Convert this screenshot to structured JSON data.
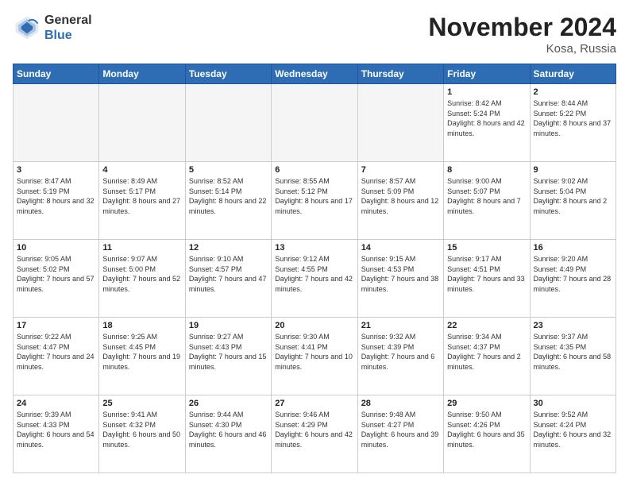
{
  "logo": {
    "general": "General",
    "blue": "Blue"
  },
  "header": {
    "month": "November 2024",
    "location": "Kosa, Russia"
  },
  "weekdays": [
    "Sunday",
    "Monday",
    "Tuesday",
    "Wednesday",
    "Thursday",
    "Friday",
    "Saturday"
  ],
  "weeks": [
    [
      {
        "day": "",
        "info": ""
      },
      {
        "day": "",
        "info": ""
      },
      {
        "day": "",
        "info": ""
      },
      {
        "day": "",
        "info": ""
      },
      {
        "day": "",
        "info": ""
      },
      {
        "day": "1",
        "info": "Sunrise: 8:42 AM\nSunset: 5:24 PM\nDaylight: 8 hours and 42 minutes."
      },
      {
        "day": "2",
        "info": "Sunrise: 8:44 AM\nSunset: 5:22 PM\nDaylight: 8 hours and 37 minutes."
      }
    ],
    [
      {
        "day": "3",
        "info": "Sunrise: 8:47 AM\nSunset: 5:19 PM\nDaylight: 8 hours and 32 minutes."
      },
      {
        "day": "4",
        "info": "Sunrise: 8:49 AM\nSunset: 5:17 PM\nDaylight: 8 hours and 27 minutes."
      },
      {
        "day": "5",
        "info": "Sunrise: 8:52 AM\nSunset: 5:14 PM\nDaylight: 8 hours and 22 minutes."
      },
      {
        "day": "6",
        "info": "Sunrise: 8:55 AM\nSunset: 5:12 PM\nDaylight: 8 hours and 17 minutes."
      },
      {
        "day": "7",
        "info": "Sunrise: 8:57 AM\nSunset: 5:09 PM\nDaylight: 8 hours and 12 minutes."
      },
      {
        "day": "8",
        "info": "Sunrise: 9:00 AM\nSunset: 5:07 PM\nDaylight: 8 hours and 7 minutes."
      },
      {
        "day": "9",
        "info": "Sunrise: 9:02 AM\nSunset: 5:04 PM\nDaylight: 8 hours and 2 minutes."
      }
    ],
    [
      {
        "day": "10",
        "info": "Sunrise: 9:05 AM\nSunset: 5:02 PM\nDaylight: 7 hours and 57 minutes."
      },
      {
        "day": "11",
        "info": "Sunrise: 9:07 AM\nSunset: 5:00 PM\nDaylight: 7 hours and 52 minutes."
      },
      {
        "day": "12",
        "info": "Sunrise: 9:10 AM\nSunset: 4:57 PM\nDaylight: 7 hours and 47 minutes."
      },
      {
        "day": "13",
        "info": "Sunrise: 9:12 AM\nSunset: 4:55 PM\nDaylight: 7 hours and 42 minutes."
      },
      {
        "day": "14",
        "info": "Sunrise: 9:15 AM\nSunset: 4:53 PM\nDaylight: 7 hours and 38 minutes."
      },
      {
        "day": "15",
        "info": "Sunrise: 9:17 AM\nSunset: 4:51 PM\nDaylight: 7 hours and 33 minutes."
      },
      {
        "day": "16",
        "info": "Sunrise: 9:20 AM\nSunset: 4:49 PM\nDaylight: 7 hours and 28 minutes."
      }
    ],
    [
      {
        "day": "17",
        "info": "Sunrise: 9:22 AM\nSunset: 4:47 PM\nDaylight: 7 hours and 24 minutes."
      },
      {
        "day": "18",
        "info": "Sunrise: 9:25 AM\nSunset: 4:45 PM\nDaylight: 7 hours and 19 minutes."
      },
      {
        "day": "19",
        "info": "Sunrise: 9:27 AM\nSunset: 4:43 PM\nDaylight: 7 hours and 15 minutes."
      },
      {
        "day": "20",
        "info": "Sunrise: 9:30 AM\nSunset: 4:41 PM\nDaylight: 7 hours and 10 minutes."
      },
      {
        "day": "21",
        "info": "Sunrise: 9:32 AM\nSunset: 4:39 PM\nDaylight: 7 hours and 6 minutes."
      },
      {
        "day": "22",
        "info": "Sunrise: 9:34 AM\nSunset: 4:37 PM\nDaylight: 7 hours and 2 minutes."
      },
      {
        "day": "23",
        "info": "Sunrise: 9:37 AM\nSunset: 4:35 PM\nDaylight: 6 hours and 58 minutes."
      }
    ],
    [
      {
        "day": "24",
        "info": "Sunrise: 9:39 AM\nSunset: 4:33 PM\nDaylight: 6 hours and 54 minutes."
      },
      {
        "day": "25",
        "info": "Sunrise: 9:41 AM\nSunset: 4:32 PM\nDaylight: 6 hours and 50 minutes."
      },
      {
        "day": "26",
        "info": "Sunrise: 9:44 AM\nSunset: 4:30 PM\nDaylight: 6 hours and 46 minutes."
      },
      {
        "day": "27",
        "info": "Sunrise: 9:46 AM\nSunset: 4:29 PM\nDaylight: 6 hours and 42 minutes."
      },
      {
        "day": "28",
        "info": "Sunrise: 9:48 AM\nSunset: 4:27 PM\nDaylight: 6 hours and 39 minutes."
      },
      {
        "day": "29",
        "info": "Sunrise: 9:50 AM\nSunset: 4:26 PM\nDaylight: 6 hours and 35 minutes."
      },
      {
        "day": "30",
        "info": "Sunrise: 9:52 AM\nSunset: 4:24 PM\nDaylight: 6 hours and 32 minutes."
      }
    ]
  ]
}
